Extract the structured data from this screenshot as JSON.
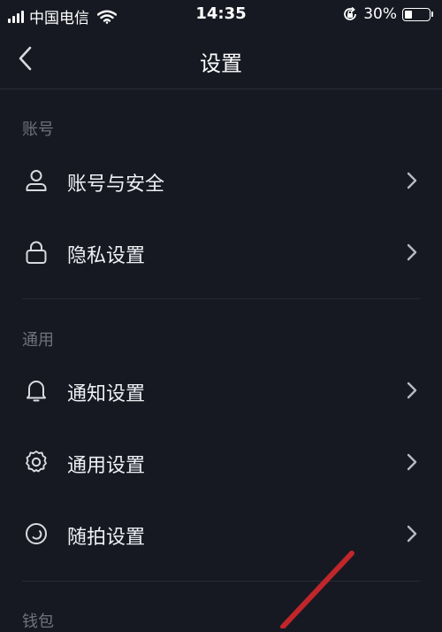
{
  "status_bar": {
    "carrier": "中国电信",
    "time": "14:35",
    "battery_percent": "30%",
    "battery_level": 0.3
  },
  "nav": {
    "title": "设置",
    "back_icon": "chevron-left-icon"
  },
  "sections": [
    {
      "header": "账号",
      "items": [
        {
          "label": "账号与安全",
          "icon": "user-icon"
        },
        {
          "label": "隐私设置",
          "icon": "lock-icon"
        }
      ]
    },
    {
      "header": "通用",
      "items": [
        {
          "label": "通知设置",
          "icon": "bell-icon"
        },
        {
          "label": "通用设置",
          "icon": "gear-icon"
        },
        {
          "label": "随拍设置",
          "icon": "capture-icon"
        }
      ]
    },
    {
      "header": "钱包",
      "items": []
    }
  ],
  "colors": {
    "background": "#171922",
    "section_header": "#6f717c",
    "annotation_stroke": "#c0262a"
  }
}
